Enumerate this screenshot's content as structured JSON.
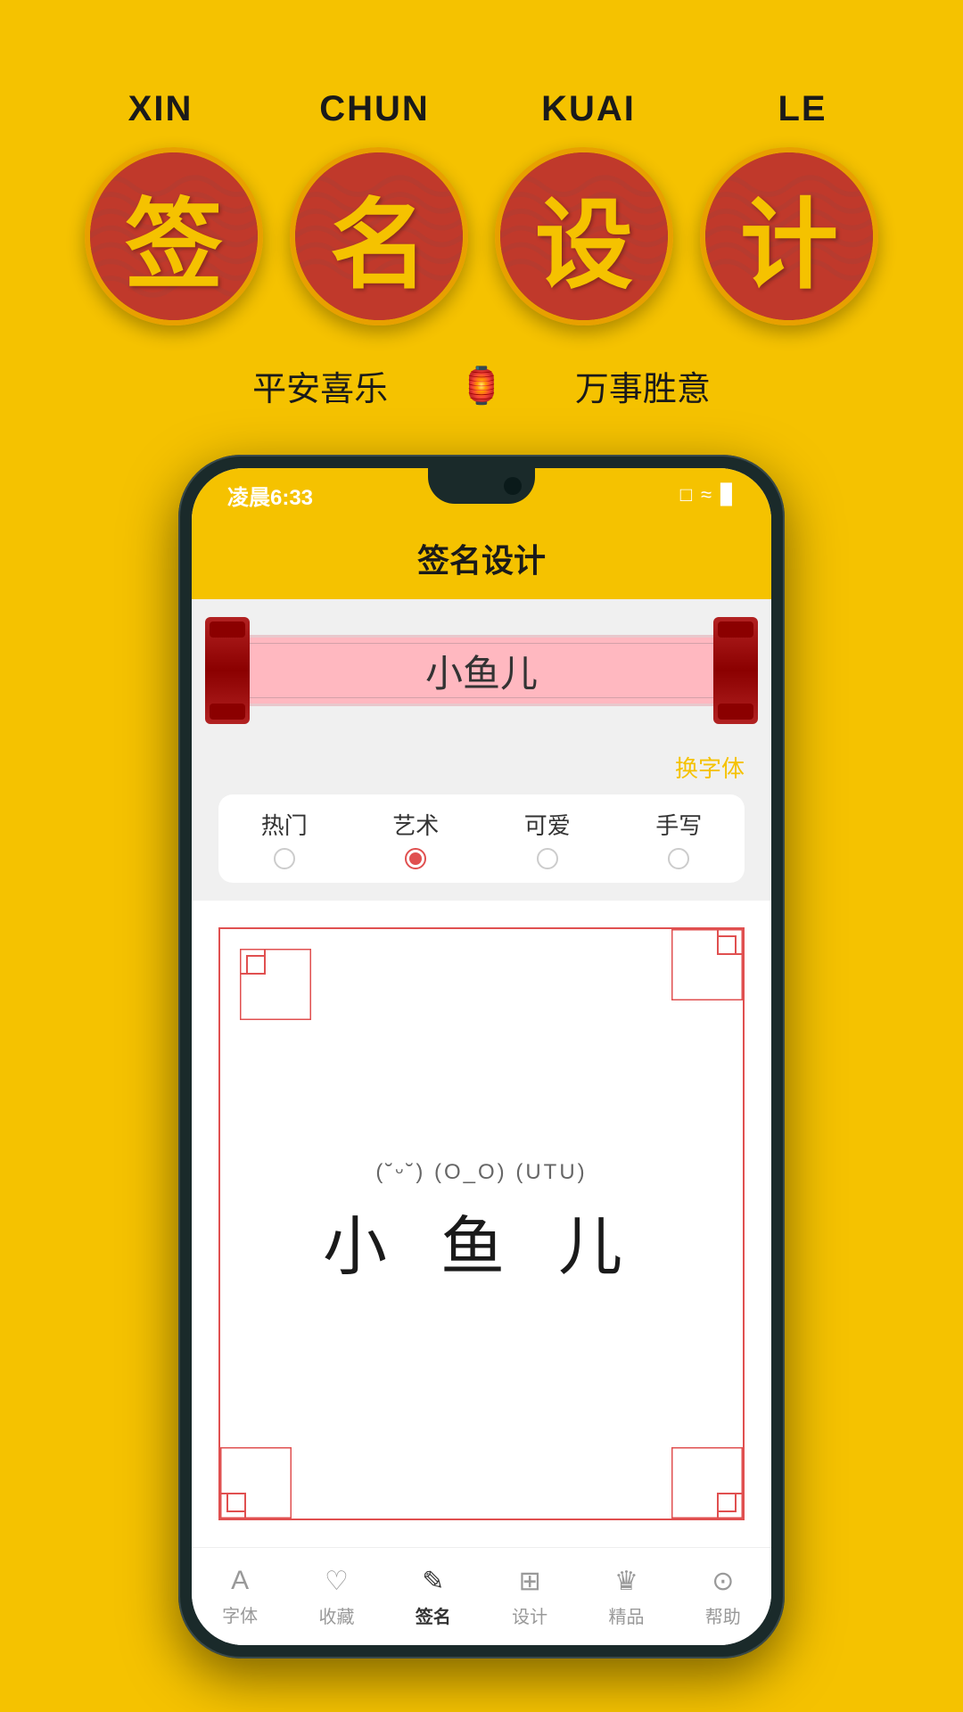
{
  "background_color": "#F5C200",
  "top": {
    "pinyin": [
      "XIN",
      "CHUN",
      "KUAI",
      "LE"
    ],
    "chars": [
      "签",
      "名",
      "设",
      "计"
    ],
    "subtitle_left": "平安喜乐",
    "subtitle_center_icon": "🏮",
    "subtitle_right": "万事胜意"
  },
  "phone": {
    "status_bar": {
      "time": "凌晨6:33",
      "icons": "□ ≈ ▊"
    },
    "app_title": "签名设计",
    "scroll": {
      "text": "小鱼儿"
    },
    "change_font": "换字体",
    "font_tabs": [
      {
        "label": "热门",
        "active": false
      },
      {
        "label": "艺术",
        "active": true
      },
      {
        "label": "可爱",
        "active": false
      },
      {
        "label": "手写",
        "active": false
      }
    ],
    "signature": {
      "kaomoji": "(˘ᵕ˘)  (O_O) (UTU)",
      "name": "小 鱼 儿"
    },
    "bottom_nav": [
      {
        "icon": "A",
        "label": "字体",
        "active": false
      },
      {
        "icon": "♡",
        "label": "收藏",
        "active": false
      },
      {
        "icon": "✎",
        "label": "签名",
        "active": true
      },
      {
        "icon": "⊞",
        "label": "设计",
        "active": false
      },
      {
        "icon": "♛",
        "label": "精品",
        "active": false
      },
      {
        "icon": "?",
        "label": "帮助",
        "active": false
      }
    ]
  }
}
